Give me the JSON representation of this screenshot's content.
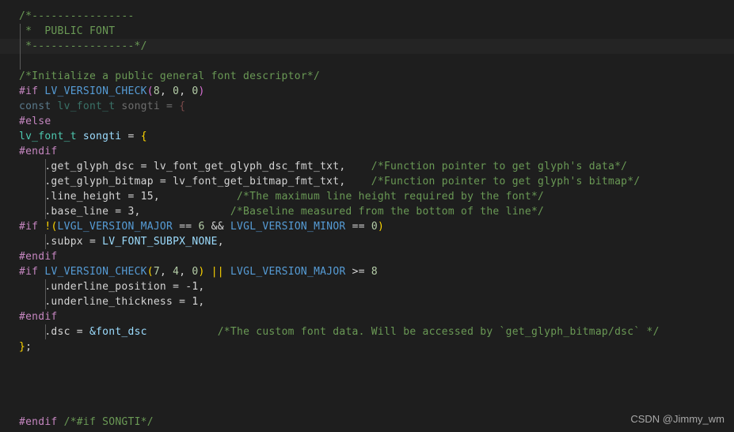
{
  "editor": {
    "background": "#1e1e1e",
    "highlight_band_color": "#242424",
    "default_text_color": "#d4d4d4",
    "language": "C",
    "font_size_px": 13,
    "line_height_px": 19
  },
  "theme": {
    "comment": "#6a9955",
    "preprocessor": "#c586c0",
    "identifier": "#569cd6",
    "type": "#4ec9b0",
    "number": "#b5cea8",
    "operator": "#d4d4d4",
    "bracket_yellow": "#ffd700",
    "bracket_magenta": "#da70d6",
    "bracket_blue": "#179fff",
    "constant": "#9cdcfe",
    "inactive_region": "#6e6e6e"
  },
  "code": {
    "line_01_comment_open": "/*----------------",
    "line_02_comment_title": " *  PUBLIC FONT",
    "line_03_comment_close": " *----------------*/",
    "line_05_comment_init": "/*Initialize a public general font descriptor*/",
    "line_06": {
      "directive": "#if",
      "macro": "LV_VERSION_CHECK",
      "paren_open": "(",
      "arg1": "8",
      "sep1": ", ",
      "arg2": "0",
      "sep2": ", ",
      "arg3": "0",
      "paren_close": ")"
    },
    "line_07_inactive": {
      "keyword": "const",
      "type": "lv_font_t",
      "name": "songti",
      "equals": "=",
      "brace": "{"
    },
    "line_08_else": "#else",
    "line_09_active": {
      "type": "lv_font_t",
      "name": "songti",
      "equals": "=",
      "brace": "{"
    },
    "line_10_endif": "#endif",
    "line_11": {
      "member": "    .get_glyph_dsc = lv_font_get_glyph_dsc_fmt_txt,",
      "comment": "/*Function pointer to get glyph's data*/"
    },
    "line_12": {
      "member": "    .get_glyph_bitmap = lv_font_get_bitmap_fmt_txt,",
      "comment": "/*Function pointer to get glyph's bitmap*/"
    },
    "line_13": {
      "member": "    .line_height = 15,",
      "comment": "/*The maximum line height required by the font*/"
    },
    "line_14": {
      "member": "    .base_line = 3,",
      "comment": "/*Baseline measured from the bottom of the line*/"
    },
    "line_15": {
      "directive": "#if",
      "bang": "!",
      "paren_open": "(",
      "macro1": "LVGL_VERSION_MAJOR",
      "op1": "==",
      "num1": "6",
      "and": "&&",
      "macro2": "LVGL_VERSION_MINOR",
      "op2": "==",
      "num2": "0",
      "paren_close": ")"
    },
    "line_16_subpx": {
      "member": "    .subpx = ",
      "constant": "LV_FONT_SUBPX_NONE",
      "comma": ","
    },
    "line_17_endif": "#endif",
    "line_18": {
      "directive": "#if",
      "macro": "LV_VERSION_CHECK",
      "paren_open": "(",
      "arg1": "7",
      "sep1": ", ",
      "arg2": "4",
      "sep2": ", ",
      "arg3": "0",
      "paren_close": ")",
      "or": "||",
      "macro2": "LVGL_VERSION_MAJOR",
      "op": ">=",
      "num": "8"
    },
    "line_19_underline_position": "    .underline_position = -1,",
    "line_20_underline_thickness": "    .underline_thickness = 1,",
    "line_21_endif": "#endif",
    "line_22": {
      "member": "    .dsc = ",
      "value": "&font_dsc",
      "comment": "/*The custom font data. Will be accessed by `get_glyph_bitmap/dsc` */"
    },
    "line_23_close": {
      "brace": "}",
      "semicolon": ";"
    },
    "line_27": {
      "directive": "#endif",
      "comment": "/*#if SONGTI*/"
    }
  },
  "watermark": {
    "text": "CSDN @Jimmy_wm"
  }
}
